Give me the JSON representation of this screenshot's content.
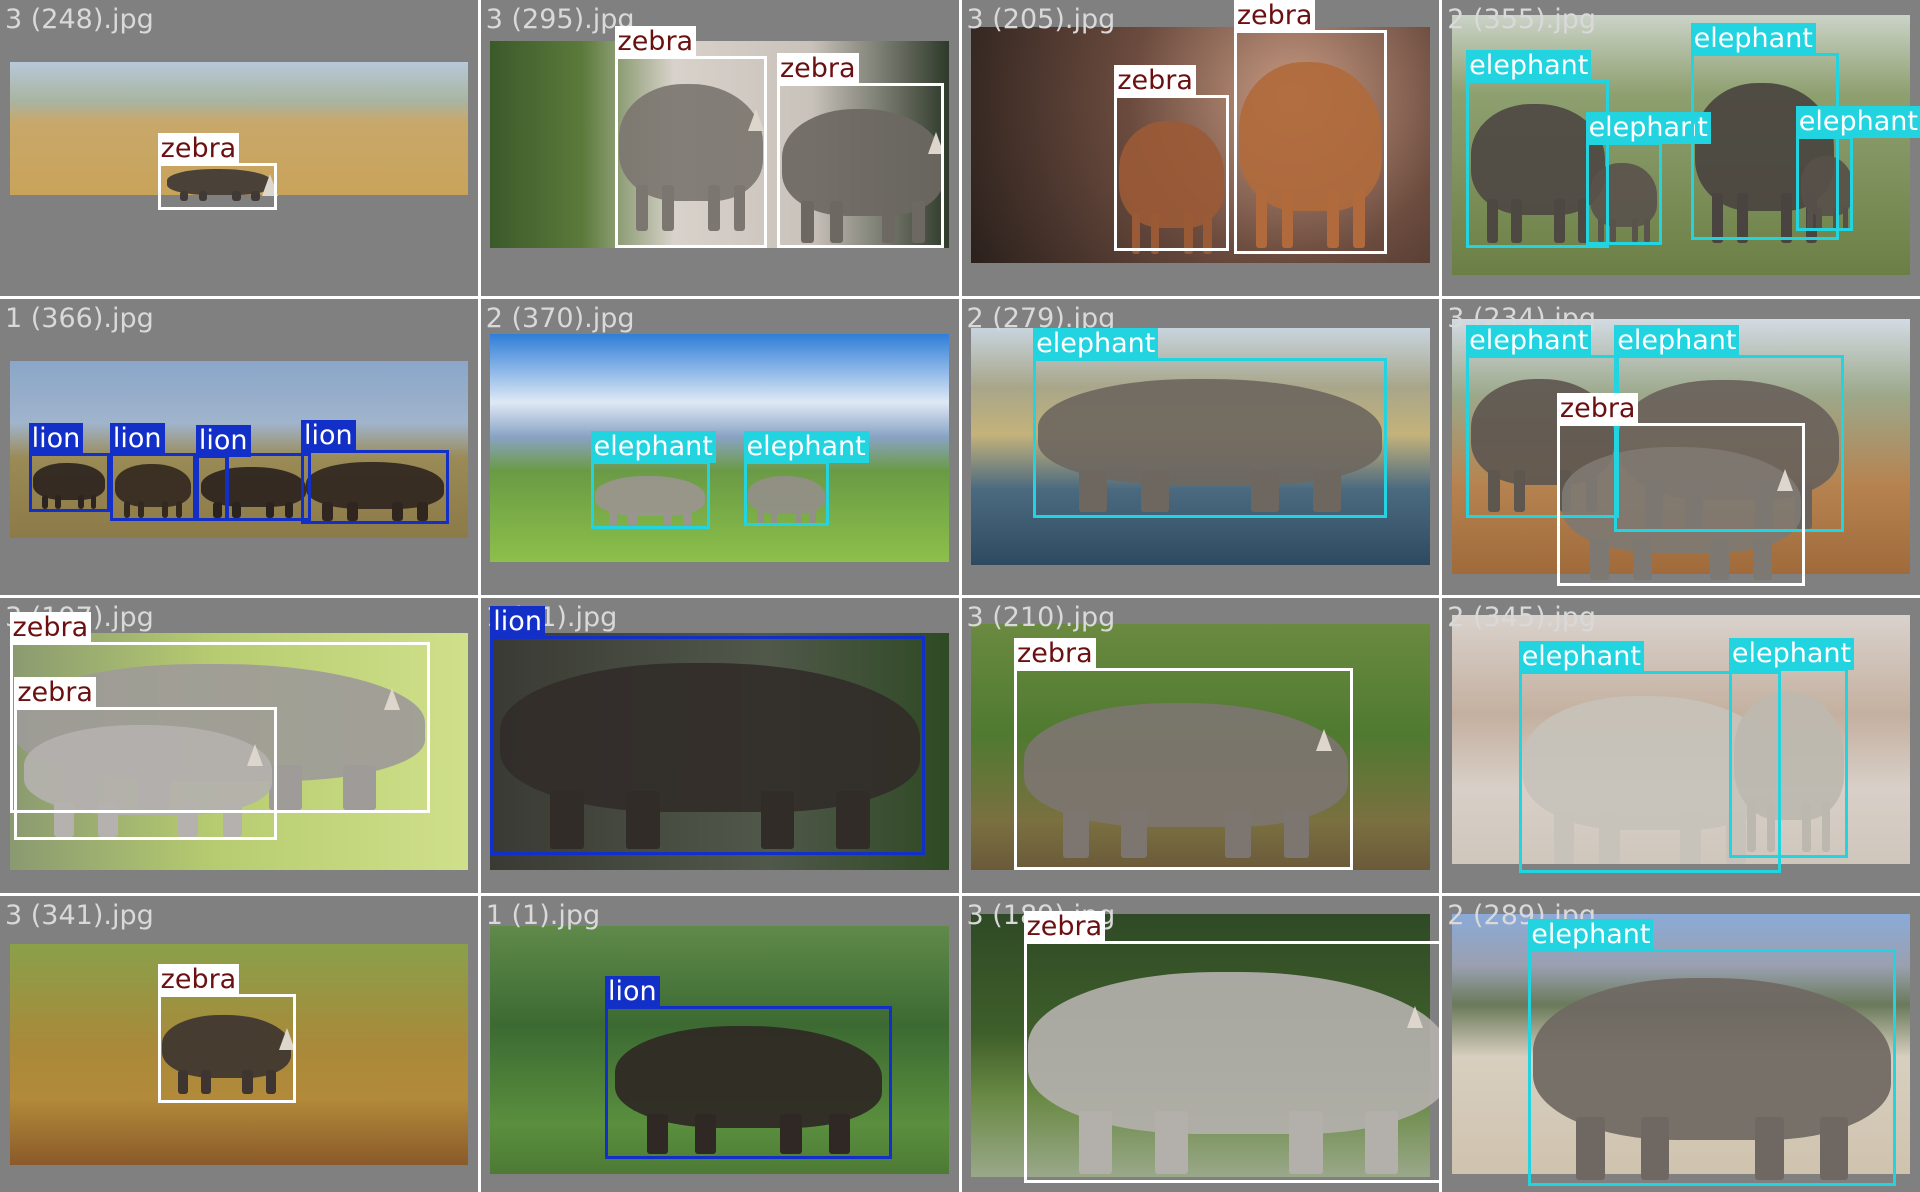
{
  "colors": {
    "panel_bg": "#808080",
    "filename_text": "#d9d9d9",
    "zebra_box": "#ffffff",
    "zebra_label_text": "#6b1010",
    "elephant_box": "#22d3e0",
    "elephant_label_text": "#ffffff",
    "lion_box": "#1230c8",
    "lion_label_text": "#ffffff"
  },
  "tiles": [
    {
      "filename": "3 (248).jpg",
      "scene": "savanna",
      "detections": [
        {
          "label": "zebra"
        }
      ]
    },
    {
      "filename": "3 (295).jpg",
      "scene": "rocks-forest",
      "detections": [
        {
          "label": "zebra"
        },
        {
          "label": "zebra"
        }
      ]
    },
    {
      "filename": "3 (205).jpg",
      "scene": "dusk",
      "detections": [
        {
          "label": "zebra"
        },
        {
          "label": "zebra"
        }
      ]
    },
    {
      "filename": "2 (355).jpg",
      "scene": "grassland",
      "detections": [
        {
          "label": "elephant"
        },
        {
          "label": "elephant"
        },
        {
          "label": "elephant"
        },
        {
          "label": "elephant"
        }
      ]
    },
    {
      "filename": "1 (366).jpg",
      "scene": "plain",
      "detections": [
        {
          "label": "lion"
        },
        {
          "label": "lion"
        },
        {
          "label": "lion"
        },
        {
          "label": "lion"
        }
      ]
    },
    {
      "filename": "2 (370).jpg",
      "scene": "mountain",
      "detections": [
        {
          "label": "elephant"
        },
        {
          "label": "elephant"
        }
      ]
    },
    {
      "filename": "2 (279).jpg",
      "scene": "water",
      "detections": [
        {
          "label": "elephant"
        }
      ]
    },
    {
      "filename": "3 (234).jpg",
      "scene": "tallgrass",
      "detections": [
        {
          "label": "elephant"
        },
        {
          "label": "elephant"
        },
        {
          "label": "zebra"
        }
      ]
    },
    {
      "filename": "3 (197).jpg",
      "scene": "greenfield",
      "detections": [
        {
          "label": "zebra"
        },
        {
          "label": "zebra"
        }
      ]
    },
    {
      "filename": "1 (91).jpg",
      "scene": "closeup",
      "detections": [
        {
          "label": "lion"
        }
      ]
    },
    {
      "filename": "3 (210).jpg",
      "scene": "bush",
      "detections": [
        {
          "label": "zebra"
        }
      ]
    },
    {
      "filename": "2 (345).jpg",
      "scene": "saltpan",
      "detections": [
        {
          "label": "elephant"
        },
        {
          "label": "elephant"
        }
      ]
    },
    {
      "filename": "3 (341).jpg",
      "scene": "woodland",
      "detections": [
        {
          "label": "zebra"
        }
      ]
    },
    {
      "filename": "1 (1).jpg",
      "scene": "jungle",
      "detections": [
        {
          "label": "lion"
        }
      ]
    },
    {
      "filename": "3 (189).jpg",
      "scene": "lawn",
      "detections": [
        {
          "label": "zebra"
        }
      ]
    },
    {
      "filename": "2 (289).jpg",
      "scene": "desert",
      "detections": [
        {
          "label": "elephant"
        }
      ]
    }
  ]
}
